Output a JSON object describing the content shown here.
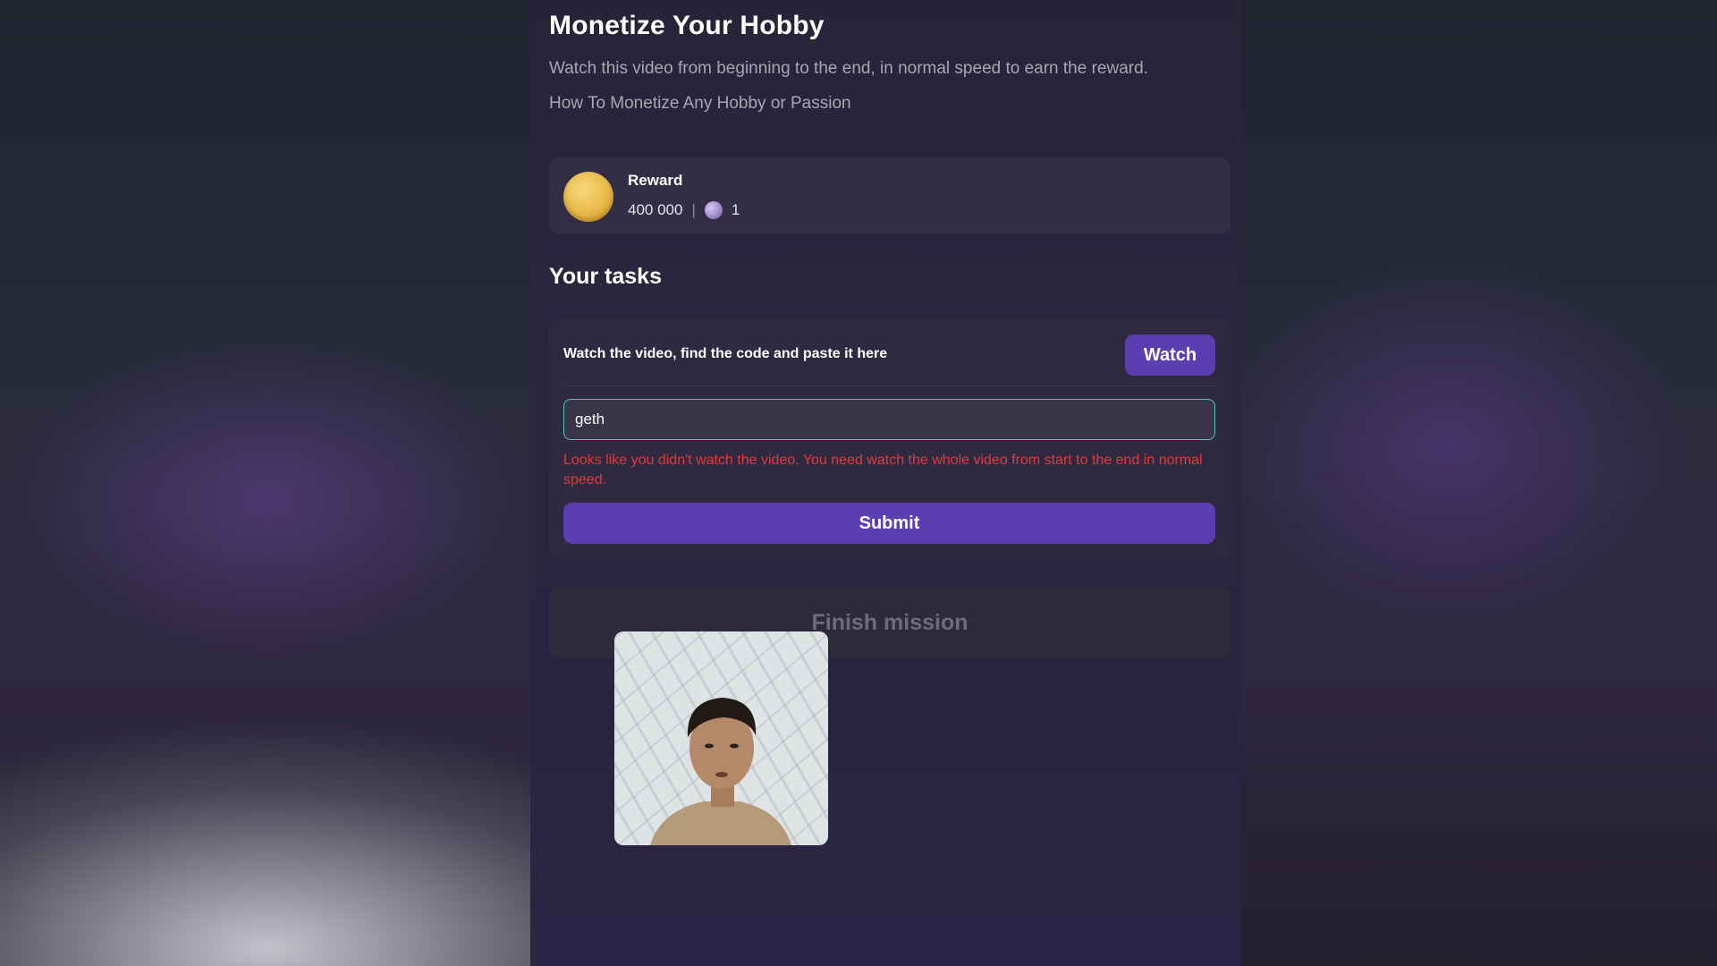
{
  "page": {
    "title": "Monetize Your Hobby",
    "subtitle": "Watch this video from beginning to the end, in normal speed to earn the reward.",
    "video_name": "How To Monetize Any Hobby or Passion"
  },
  "reward": {
    "label": "Reward",
    "coins": "400 000",
    "separator": "|",
    "gems": "1",
    "coin_icon": "gold-coin-icon",
    "gem_icon": "purple-gem-icon"
  },
  "tasks": {
    "heading": "Your tasks",
    "instruction": "Watch the video, find the code and paste it here",
    "watch_label": "Watch",
    "code_value": "geth",
    "error": "Looks like you didn't watch the video. You need watch the whole video from start to the end in normal speed.",
    "submit_label": "Submit"
  },
  "finish": {
    "label": "Finish mission"
  },
  "colors": {
    "accent": "#5b3fb0",
    "error": "#e23a3a",
    "input_border": "#4fc4b8"
  }
}
